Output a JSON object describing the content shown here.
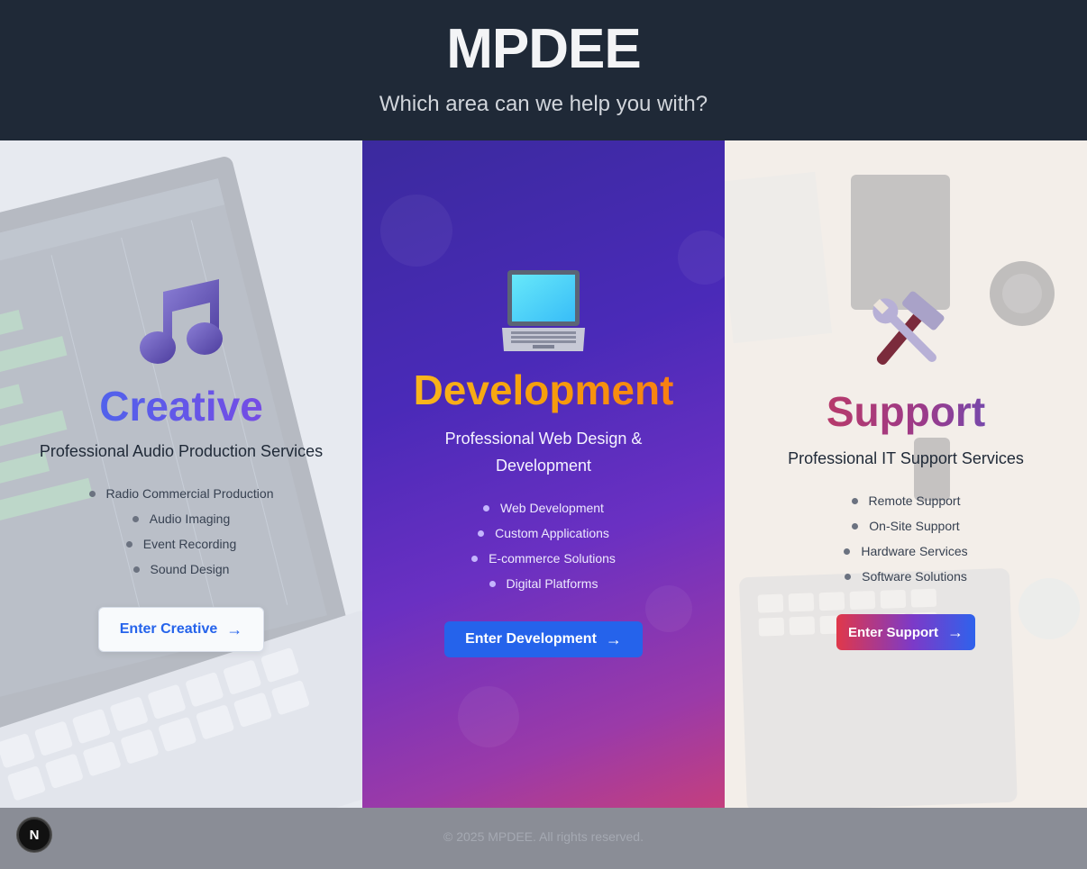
{
  "header": {
    "brand": "MPDEE",
    "tagline": "Which area can we help you with?"
  },
  "panels": {
    "creative": {
      "icon": "music-note-icon",
      "title": "Creative",
      "subtitle": "Professional Audio Production Services",
      "services": [
        "Radio Commercial Production",
        "Audio Imaging",
        "Event Recording",
        "Sound Design"
      ],
      "button_label": "Enter Creative",
      "button_arrow": "→"
    },
    "development": {
      "icon": "laptop-icon",
      "title": "Development",
      "subtitle_line1": "Professional Web Design &",
      "subtitle_line2": "Development",
      "services": [
        "Web Development",
        "Custom Applications",
        "E-commerce Solutions",
        "Digital Platforms"
      ],
      "button_label": "Enter Development",
      "button_arrow": "→"
    },
    "support": {
      "icon": "hammer-wrench-icon",
      "title": "Support",
      "subtitle": "Professional IT Support Services",
      "services": [
        "Remote Support",
        "On-Site Support",
        "Hardware Services",
        "Software Solutions"
      ],
      "button_label": "Enter Support",
      "button_arrow": "→"
    }
  },
  "footer": {
    "copyright": "© 2025 MPDEE. All rights reserved."
  },
  "dev_badge": {
    "label": "N"
  },
  "colors": {
    "header_bg": "#1f2937",
    "creative_gradient": [
      "#3b6ff0",
      "#8b3fe0"
    ],
    "development_gradient": [
      "#fbbf24",
      "#f97316"
    ],
    "support_gradient": [
      "#d43a4a",
      "#3b5fe0"
    ],
    "primary_button": "#2563eb"
  }
}
